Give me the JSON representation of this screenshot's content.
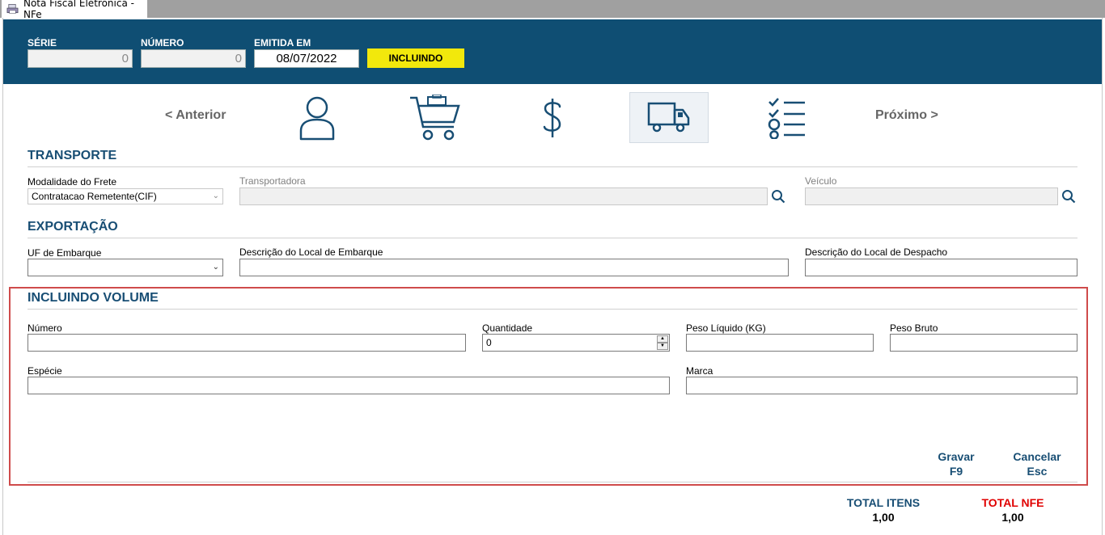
{
  "tab": {
    "title": "Nota Fiscal Eletrônica - NFe",
    "icon": "printer-icon"
  },
  "header": {
    "serie_label": "SÉRIE",
    "serie_value": "0",
    "numero_label": "NÚMERO",
    "numero_value": "0",
    "emitida_label": "EMITIDA EM",
    "emitida_value": "08/07/2022",
    "status": "INCLUINDO"
  },
  "nav": {
    "prev_label": "< Anterior",
    "next_label": "Próximo >",
    "steps": [
      "person-icon",
      "cart-icon",
      "dollar-icon",
      "truck-icon",
      "checklist-icon"
    ],
    "active_step": "truck-icon"
  },
  "transporte": {
    "title": "TRANSPORTE",
    "modalidade_label": "Modalidade do Frete",
    "modalidade_value": "Contratacao Remetente(CIF)",
    "transportadora_label": "Transportadora",
    "transportadora_value": "",
    "veiculo_label": "Veículo",
    "veiculo_value": ""
  },
  "exportacao": {
    "title": "EXPORTAÇÃO",
    "uf_label": "UF de Embarque",
    "uf_value": "",
    "local_embarque_label": "Descrição do Local de Embarque",
    "local_embarque_value": "",
    "local_despacho_label": "Descrição do Local de Despacho",
    "local_despacho_value": ""
  },
  "volume": {
    "title": "INCLUINDO VOLUME",
    "numero_label": "Número",
    "numero_value": "",
    "quantidade_label": "Quantidade",
    "quantidade_value": "0",
    "peso_liquido_label": "Peso Líquido (KG)",
    "peso_liquido_value": "",
    "peso_bruto_label": "Peso Bruto",
    "peso_bruto_value": "",
    "especie_label": "Espécie",
    "especie_value": "",
    "marca_label": "Marca",
    "marca_value": "",
    "gravar_label": "Gravar",
    "gravar_key": "F9",
    "cancelar_label": "Cancelar",
    "cancelar_key": "Esc"
  },
  "totals": {
    "itens_label": "TOTAL ITENS",
    "itens_value": "1,00",
    "nfe_label": "TOTAL NFE",
    "nfe_value": "1,00"
  },
  "colors": {
    "header_bg": "#0f4e73",
    "accent": "#184e74",
    "status_bg": "#f2e80c",
    "highlight_border": "#cf4b4b",
    "total_nfe": "#e00000"
  }
}
